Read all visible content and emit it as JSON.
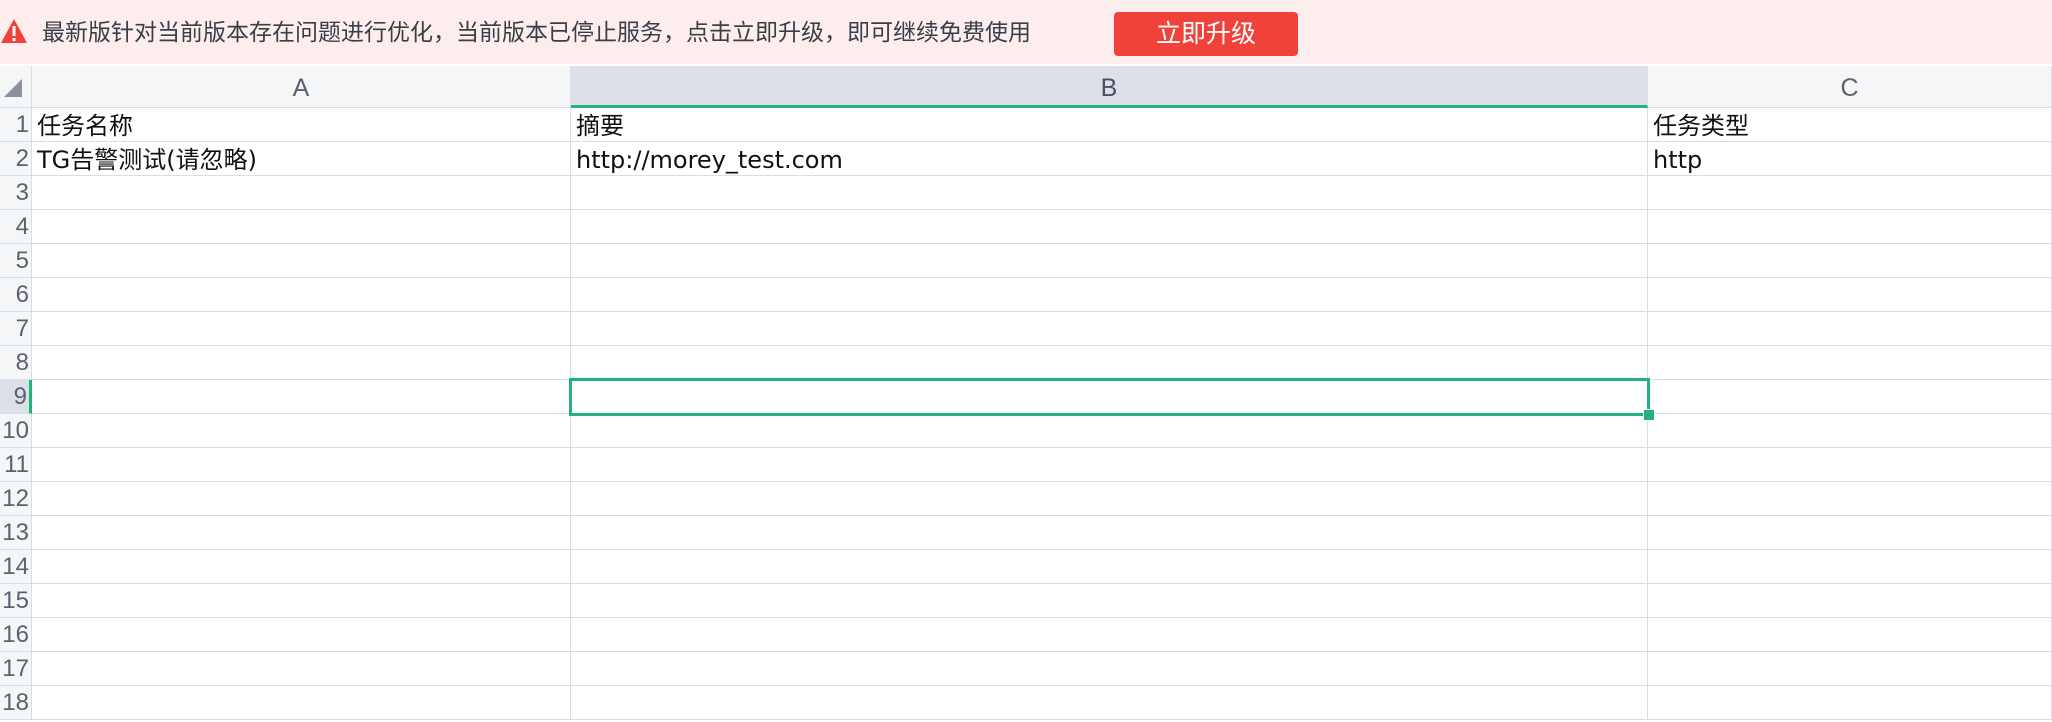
{
  "banner": {
    "icon": "warning-icon",
    "message": "最新版针对当前版本存在问题进行优化，当前版本已停止服务，点击立即升级，即可继续免费使用",
    "button_label": "立即升级",
    "button_color": "#f1413b",
    "background": "#fdeeed"
  },
  "sheet": {
    "columns": [
      "A",
      "B",
      "C"
    ],
    "active_column": "B",
    "active_row": "9",
    "accent": "#21b37a",
    "rows": [
      {
        "num": "1",
        "cells": [
          "任务名称",
          "摘要",
          "任务类型"
        ]
      },
      {
        "num": "2",
        "cells": [
          "TG告警测试(请忽略)",
          "http://morey_test.com",
          "http"
        ]
      },
      {
        "num": "3",
        "cells": [
          "",
          "",
          ""
        ]
      },
      {
        "num": "4",
        "cells": [
          "",
          "",
          ""
        ]
      },
      {
        "num": "5",
        "cells": [
          "",
          "",
          ""
        ]
      },
      {
        "num": "6",
        "cells": [
          "",
          "",
          ""
        ]
      },
      {
        "num": "7",
        "cells": [
          "",
          "",
          ""
        ]
      },
      {
        "num": "8",
        "cells": [
          "",
          "",
          ""
        ]
      },
      {
        "num": "9",
        "cells": [
          "",
          "",
          ""
        ]
      },
      {
        "num": "10",
        "cells": [
          "",
          "",
          ""
        ]
      },
      {
        "num": "11",
        "cells": [
          "",
          "",
          ""
        ]
      },
      {
        "num": "12",
        "cells": [
          "",
          "",
          ""
        ]
      },
      {
        "num": "13",
        "cells": [
          "",
          "",
          ""
        ]
      },
      {
        "num": "14",
        "cells": [
          "",
          "",
          ""
        ]
      },
      {
        "num": "15",
        "cells": [
          "",
          "",
          ""
        ]
      },
      {
        "num": "16",
        "cells": [
          "",
          "",
          ""
        ]
      },
      {
        "num": "17",
        "cells": [
          "",
          "",
          ""
        ]
      },
      {
        "num": "18",
        "cells": [
          "",
          "",
          ""
        ]
      }
    ]
  }
}
